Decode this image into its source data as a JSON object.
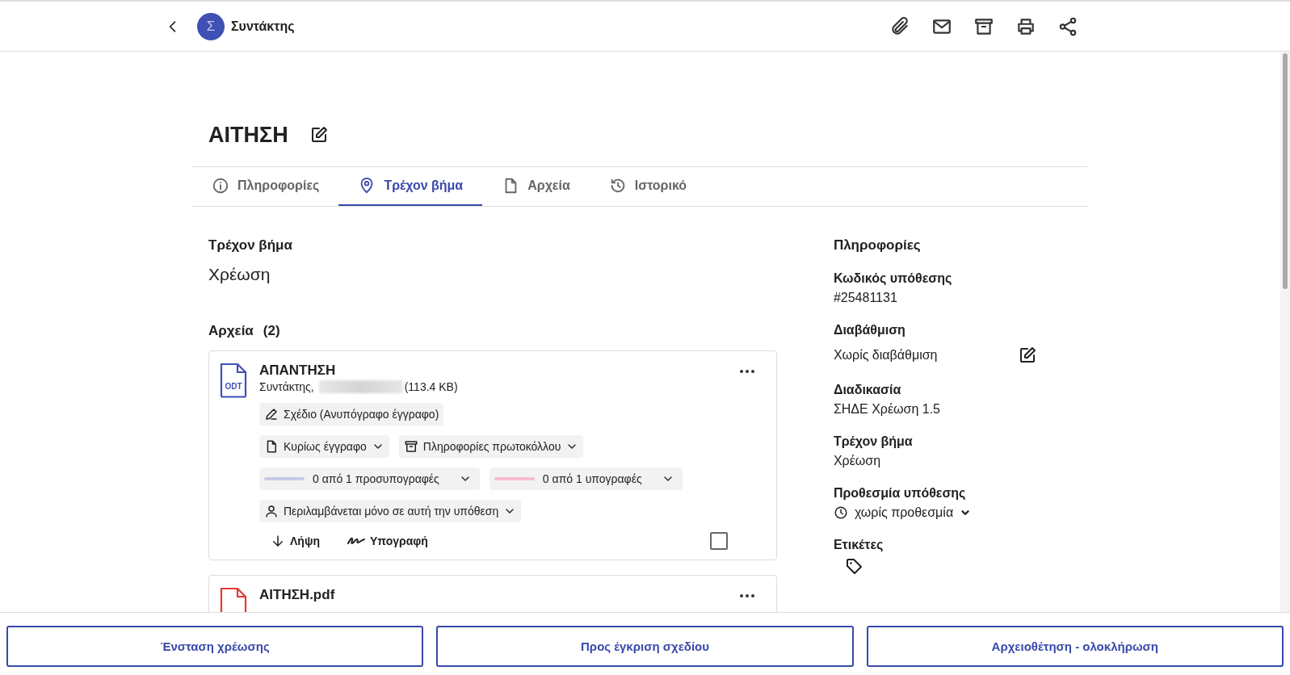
{
  "header": {
    "avatar": "Σ",
    "app_name": "Συντάκτης"
  },
  "title": "ΑΙΤΗΣΗ",
  "tabs": [
    {
      "label": "Πληροφορίες",
      "kind": "info",
      "selected": false
    },
    {
      "label": "Τρέχον βήμα",
      "kind": "location",
      "selected": true
    },
    {
      "label": "Αρχεία",
      "kind": "files",
      "selected": false
    },
    {
      "label": "Ιστορικό",
      "kind": "history",
      "selected": false
    }
  ],
  "current_step": {
    "heading": "Τρέχον βήμα",
    "value": "Χρέωση"
  },
  "files": {
    "heading": "Αρχεία",
    "count": "(2)",
    "items": [
      {
        "kind": "odt",
        "badge": "ODT",
        "name": "ΑΠΑΝΤΗΣΗ",
        "author": "Συντάκτης,",
        "size": "(113.4 KB)",
        "status": "Σχέδιο (Ανυπόγραφο έγγραφο)",
        "role": "Κυρίως έγγραφο",
        "protocol": "Πληροφορίες πρωτοκόλλου",
        "progress": [
          {
            "label": "0 από 1 προσυπογραφές",
            "color": "#c5cae9",
            "level": 0
          },
          {
            "label": "0 από 1 υπογραφές",
            "color": "#f8bbd0",
            "level": 0
          }
        ],
        "scope": "Περιλαμβάνεται μόνο σε αυτή την υπόθεση",
        "download": "Λήψη",
        "sign": "Υπογραφή",
        "checked": false
      },
      {
        "kind": "pdf",
        "name": "ΑΙΤΗΣΗ.pdf"
      }
    ]
  },
  "info": {
    "heading": "Πληροφορίες",
    "fields": [
      {
        "kind": "text",
        "label": "Κωδικός υπόθεσης",
        "value": "#25481131"
      },
      {
        "kind": "editable",
        "label": "Διαβάθμιση",
        "value": "Χωρίς διαβάθμιση"
      },
      {
        "kind": "text",
        "label": "Διαδικασία",
        "value": "ΣΗΔΕ Χρέωση 1.5"
      },
      {
        "kind": "text",
        "label": "Τρέχον βήμα",
        "value": "Χρέωση"
      },
      {
        "kind": "deadline",
        "label": "Προθεσμία υπόθεσης",
        "value": "χωρίς προθεσμία"
      },
      {
        "kind": "tags",
        "label": "Ετικέτες"
      }
    ]
  },
  "footer_buttons": [
    "Ένσταση χρέωσης",
    "Προς έγκριση σχεδίου",
    "Αρχειοθέτηση - ολοκλήρωση"
  ]
}
